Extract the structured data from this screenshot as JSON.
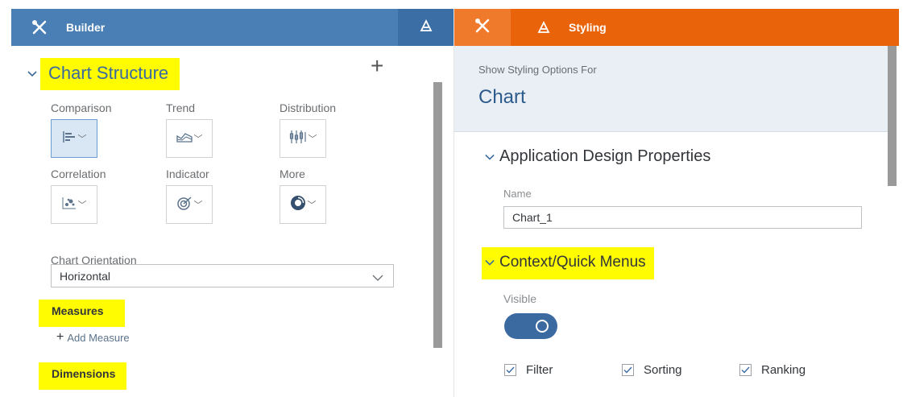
{
  "builder": {
    "tab_label": "Builder",
    "section_title": "Chart Structure",
    "add_label": "+",
    "chart_types": [
      {
        "label": "Comparison",
        "icon": "bar-chart-icon",
        "selected": true
      },
      {
        "label": "Trend",
        "icon": "area-chart-icon",
        "selected": false
      },
      {
        "label": "Distribution",
        "icon": "box-plot-icon",
        "selected": false
      },
      {
        "label": "Correlation",
        "icon": "scatter-chart-icon",
        "selected": false
      },
      {
        "label": "Indicator",
        "icon": "target-icon",
        "selected": false
      },
      {
        "label": "More",
        "icon": "donut-chart-icon",
        "selected": false
      }
    ],
    "orientation_label": "Chart Orientation",
    "orientation_value": "Horizontal",
    "measures_label": "Measures",
    "add_measure_label": "Add Measure",
    "dimensions_label": "Dimensions"
  },
  "styling": {
    "tab_label": "Styling",
    "show_options_label": "Show Styling Options For",
    "show_options_value": "Chart",
    "app_design_title": "Application Design Properties",
    "name_label": "Name",
    "name_value": "Chart_1",
    "context_menus_title": "Context/Quick Menus",
    "visible_label": "Visible",
    "visible_on": true,
    "checkboxes": [
      {
        "label": "Filter",
        "checked": true
      },
      {
        "label": "Sorting",
        "checked": true
      },
      {
        "label": "Ranking",
        "checked": true
      }
    ]
  },
  "colors": {
    "builder_header": "#4a7fb5",
    "styling_header": "#e8630a",
    "highlight": "#fffb00",
    "accent_blue": "#3a6aa0"
  }
}
